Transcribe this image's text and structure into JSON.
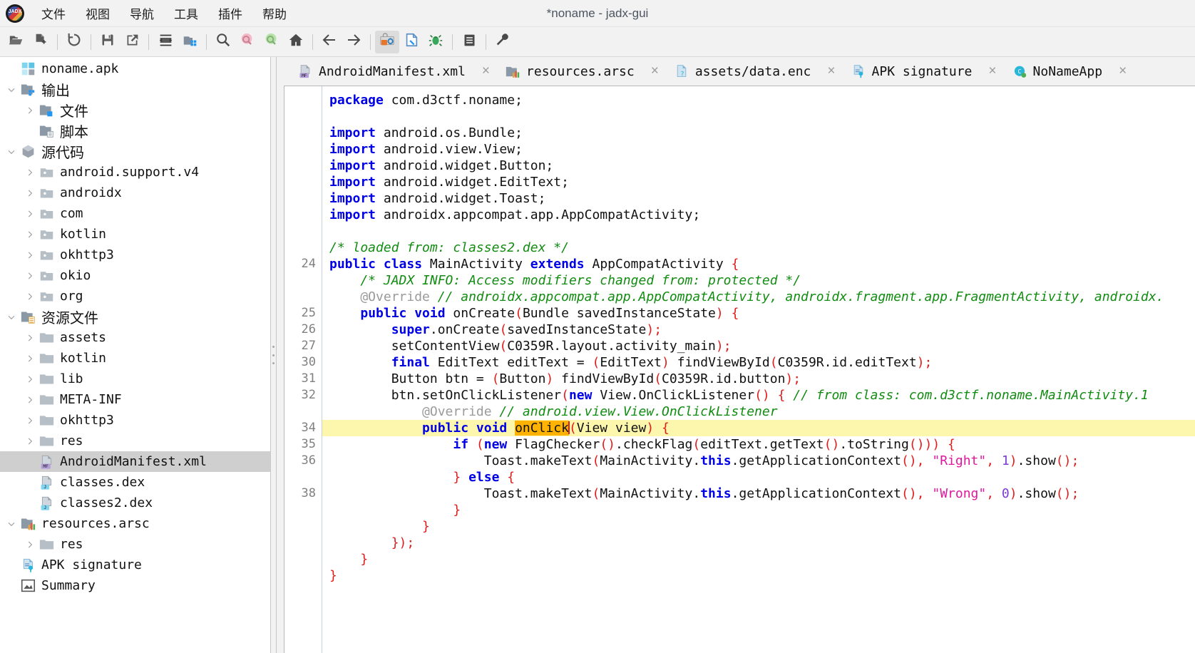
{
  "window": {
    "title": "*noname - jadx-gui",
    "logo_alt": "jadx-logo"
  },
  "menu": [
    {
      "label": "文件",
      "name": "menu-file"
    },
    {
      "label": "视图",
      "name": "menu-view"
    },
    {
      "label": "导航",
      "name": "menu-navigation"
    },
    {
      "label": "工具",
      "name": "menu-tools"
    },
    {
      "label": "插件",
      "name": "menu-plugins"
    },
    {
      "label": "帮助",
      "name": "menu-help"
    }
  ],
  "toolbar": [
    {
      "icon": "open-folder-icon",
      "name": "open-file-button"
    },
    {
      "icon": "add-files-icon",
      "name": "add-files-button"
    },
    {
      "sep": true
    },
    {
      "icon": "reload-icon",
      "name": "reload-button"
    },
    {
      "sep": true
    },
    {
      "icon": "save-icon",
      "name": "save-all-button"
    },
    {
      "icon": "export-icon",
      "name": "export-gradle-button"
    },
    {
      "sep": true
    },
    {
      "icon": "decompile-icon",
      "name": "sync-button"
    },
    {
      "icon": "open-project-icon",
      "name": "project-button"
    },
    {
      "sep": true
    },
    {
      "icon": "search-icon",
      "name": "text-search-button"
    },
    {
      "icon": "search-pink-icon",
      "name": "class-search-button"
    },
    {
      "icon": "search-green-icon",
      "name": "comment-search-button"
    },
    {
      "icon": "home-icon",
      "name": "home-button"
    },
    {
      "sep": true
    },
    {
      "icon": "arrow-back-icon",
      "name": "back-button"
    },
    {
      "icon": "arrow-forward-icon",
      "name": "forward-button"
    },
    {
      "sep": true
    },
    {
      "icon": "deobfuscation-icon",
      "name": "deobfuscation-button",
      "active": true
    },
    {
      "icon": "quark-icon",
      "name": "quark-button"
    },
    {
      "icon": "bug-icon",
      "name": "debugger-button"
    },
    {
      "sep": true
    },
    {
      "icon": "log-icon",
      "name": "logs-button"
    },
    {
      "sep": true
    },
    {
      "icon": "wrench-icon",
      "name": "preferences-button"
    }
  ],
  "sidebar": {
    "nodes": [
      {
        "label": "noname.apk",
        "indent": 0,
        "twisty": "none",
        "icon": "apk-icon",
        "cjk": false
      },
      {
        "label": "输出",
        "indent": 0,
        "twisty": "expanded",
        "icon": "folder-out-icon",
        "cjk": true
      },
      {
        "label": "文件",
        "indent": 1,
        "twisty": "collapsed",
        "icon": "folder-blue-icon",
        "cjk": true
      },
      {
        "label": "脚本",
        "indent": 1,
        "twisty": "none",
        "icon": "folder-doc-icon",
        "cjk": true
      },
      {
        "label": "源代码",
        "indent": 0,
        "twisty": "expanded",
        "icon": "package-icon",
        "cjk": true
      },
      {
        "label": "android.support.v4",
        "indent": 1,
        "twisty": "collapsed",
        "icon": "pkg-folder-icon",
        "cjk": false
      },
      {
        "label": "androidx",
        "indent": 1,
        "twisty": "collapsed",
        "icon": "pkg-folder-icon",
        "cjk": false
      },
      {
        "label": "com",
        "indent": 1,
        "twisty": "collapsed",
        "icon": "pkg-folder-icon",
        "cjk": false
      },
      {
        "label": "kotlin",
        "indent": 1,
        "twisty": "collapsed",
        "icon": "pkg-folder-icon",
        "cjk": false
      },
      {
        "label": "okhttp3",
        "indent": 1,
        "twisty": "collapsed",
        "icon": "pkg-folder-icon",
        "cjk": false
      },
      {
        "label": "okio",
        "indent": 1,
        "twisty": "collapsed",
        "icon": "pkg-folder-icon",
        "cjk": false
      },
      {
        "label": "org",
        "indent": 1,
        "twisty": "collapsed",
        "icon": "pkg-folder-icon",
        "cjk": false
      },
      {
        "label": "资源文件",
        "indent": 0,
        "twisty": "expanded",
        "icon": "folder-res-icon",
        "cjk": true
      },
      {
        "label": "assets",
        "indent": 1,
        "twisty": "collapsed",
        "icon": "folder-icon",
        "cjk": false
      },
      {
        "label": "kotlin",
        "indent": 1,
        "twisty": "collapsed",
        "icon": "folder-icon",
        "cjk": false
      },
      {
        "label": "lib",
        "indent": 1,
        "twisty": "collapsed",
        "icon": "folder-icon",
        "cjk": false
      },
      {
        "label": "META-INF",
        "indent": 1,
        "twisty": "collapsed",
        "icon": "folder-icon",
        "cjk": false
      },
      {
        "label": "okhttp3",
        "indent": 1,
        "twisty": "collapsed",
        "icon": "folder-icon",
        "cjk": false
      },
      {
        "label": "res",
        "indent": 1,
        "twisty": "collapsed",
        "icon": "folder-icon",
        "cjk": false
      },
      {
        "label": "AndroidManifest.xml",
        "indent": 1,
        "twisty": "none",
        "icon": "manifest-icon",
        "cjk": false,
        "selected": true
      },
      {
        "label": "classes.dex",
        "indent": 1,
        "twisty": "none",
        "icon": "dex-icon",
        "cjk": false
      },
      {
        "label": "classes2.dex",
        "indent": 1,
        "twisty": "none",
        "icon": "dex-icon",
        "cjk": false
      },
      {
        "label": "resources.arsc",
        "indent": 0,
        "twisty": "expanded",
        "icon": "arsc-icon",
        "cjk": false
      },
      {
        "label": "res",
        "indent": 1,
        "twisty": "collapsed",
        "icon": "folder-icon",
        "cjk": false
      },
      {
        "label": "APK signature",
        "indent": -1,
        "twisty": "none",
        "icon": "signature-icon",
        "cjk": false
      },
      {
        "label": "Summary",
        "indent": -1,
        "twisty": "none",
        "icon": "summary-icon",
        "cjk": false
      }
    ]
  },
  "tabs": [
    {
      "label": "AndroidManifest.xml",
      "icon": "manifest-icon",
      "close": "×",
      "name": "tab-androidmanifest-xml"
    },
    {
      "label": "resources.arsc",
      "icon": "arsc-icon",
      "close": "×",
      "name": "tab-resources-arsc"
    },
    {
      "label": "assets/data.enc",
      "icon": "unknown-file-icon",
      "close": "×",
      "name": "tab-assets-data-enc"
    },
    {
      "label": "APK signature",
      "icon": "signature-icon",
      "close": "×",
      "name": "tab-apk-signature"
    },
    {
      "label": "NoNameApp",
      "icon": "class-icon",
      "close": "×",
      "name": "tab-nonameapp"
    }
  ],
  "code": {
    "lines": [
      {
        "num": "",
        "segments": [
          {
            "t": "package ",
            "c": "kw"
          },
          {
            "t": "com.d3ctf.noname;",
            "c": ""
          }
        ]
      },
      {
        "num": "",
        "segments": []
      },
      {
        "num": "",
        "segments": [
          {
            "t": "import ",
            "c": "kw"
          },
          {
            "t": "android.os.Bundle;",
            "c": ""
          }
        ]
      },
      {
        "num": "",
        "segments": [
          {
            "t": "import ",
            "c": "kw"
          },
          {
            "t": "android.view.View;",
            "c": ""
          }
        ]
      },
      {
        "num": "",
        "segments": [
          {
            "t": "import ",
            "c": "kw"
          },
          {
            "t": "android.widget.Button;",
            "c": ""
          }
        ]
      },
      {
        "num": "",
        "segments": [
          {
            "t": "import ",
            "c": "kw"
          },
          {
            "t": "android.widget.EditText;",
            "c": ""
          }
        ]
      },
      {
        "num": "",
        "segments": [
          {
            "t": "import ",
            "c": "kw"
          },
          {
            "t": "android.widget.Toast;",
            "c": ""
          }
        ]
      },
      {
        "num": "",
        "segments": [
          {
            "t": "import ",
            "c": "kw"
          },
          {
            "t": "androidx.appcompat.app.AppCompatActivity;",
            "c": ""
          }
        ]
      },
      {
        "num": "",
        "segments": []
      },
      {
        "num": "",
        "segments": [
          {
            "t": "/* loaded from: classes2.dex */",
            "c": "cm"
          }
        ]
      },
      {
        "num": "24",
        "segments": [
          {
            "t": "public class ",
            "c": "kw"
          },
          {
            "t": "MainActivity ",
            "c": ""
          },
          {
            "t": "extends ",
            "c": "kw"
          },
          {
            "t": "AppCompatActivity ",
            "c": ""
          },
          {
            "t": "{",
            "c": "pn"
          }
        ]
      },
      {
        "num": "",
        "segments": [
          {
            "t": "    /* JADX INFO: Access modifiers changed from: protected */",
            "c": "cm"
          }
        ]
      },
      {
        "num": "",
        "segments": [
          {
            "t": "    @Override ",
            "c": "an"
          },
          {
            "t": "// androidx.appcompat.app.AppCompatActivity, androidx.fragment.app.FragmentActivity, androidx.",
            "c": "cm"
          }
        ]
      },
      {
        "num": "25",
        "segments": [
          {
            "t": "    ",
            "c": ""
          },
          {
            "t": "public void ",
            "c": "kw"
          },
          {
            "t": "onCreate",
            "c": ""
          },
          {
            "t": "(",
            "c": "pn"
          },
          {
            "t": "Bundle savedInstanceState",
            "c": ""
          },
          {
            "t": ") {",
            "c": "pn"
          }
        ]
      },
      {
        "num": "26",
        "segments": [
          {
            "t": "        ",
            "c": ""
          },
          {
            "t": "super",
            "c": "kw"
          },
          {
            "t": ".onCreate",
            "c": ""
          },
          {
            "t": "(",
            "c": "pn"
          },
          {
            "t": "savedInstanceState",
            "c": ""
          },
          {
            "t": ");",
            "c": "pn"
          }
        ]
      },
      {
        "num": "27",
        "segments": [
          {
            "t": "        setContentView",
            "c": ""
          },
          {
            "t": "(",
            "c": "pn"
          },
          {
            "t": "C0359R.layout.activity_main",
            "c": ""
          },
          {
            "t": ");",
            "c": "pn"
          }
        ]
      },
      {
        "num": "30",
        "segments": [
          {
            "t": "        ",
            "c": ""
          },
          {
            "t": "final ",
            "c": "kw"
          },
          {
            "t": "EditText editText = ",
            "c": ""
          },
          {
            "t": "(",
            "c": "pn"
          },
          {
            "t": "EditText",
            "c": ""
          },
          {
            "t": ") ",
            "c": "pn"
          },
          {
            "t": "findViewById",
            "c": ""
          },
          {
            "t": "(",
            "c": "pn"
          },
          {
            "t": "C0359R.id.editText",
            "c": ""
          },
          {
            "t": ");",
            "c": "pn"
          }
        ]
      },
      {
        "num": "31",
        "segments": [
          {
            "t": "        Button btn = ",
            "c": ""
          },
          {
            "t": "(",
            "c": "pn"
          },
          {
            "t": "Button",
            "c": ""
          },
          {
            "t": ") ",
            "c": "pn"
          },
          {
            "t": "findViewById",
            "c": ""
          },
          {
            "t": "(",
            "c": "pn"
          },
          {
            "t": "C0359R.id.button",
            "c": ""
          },
          {
            "t": ");",
            "c": "pn"
          }
        ]
      },
      {
        "num": "32",
        "segments": [
          {
            "t": "        btn.setOnClickListener",
            "c": ""
          },
          {
            "t": "(",
            "c": "pn"
          },
          {
            "t": "new ",
            "c": "kw"
          },
          {
            "t": "View.OnClickListener",
            "c": ""
          },
          {
            "t": "()",
            "c": "pn"
          },
          {
            "t": " ",
            "c": ""
          },
          {
            "t": "{",
            "c": "pn"
          },
          {
            "t": " // from class: com.d3ctf.noname.MainActivity.1",
            "c": "cm"
          }
        ]
      },
      {
        "num": "",
        "segments": [
          {
            "t": "            @Override ",
            "c": "an"
          },
          {
            "t": "// android.view.View.OnClickListener",
            "c": "cm"
          }
        ]
      },
      {
        "num": "34",
        "hl": true,
        "segments": [
          {
            "t": "            ",
            "c": ""
          },
          {
            "t": "public void ",
            "c": "kw"
          },
          {
            "t": "onClick",
            "c": "sel",
            "caret": true
          },
          {
            "t": "(",
            "c": "pn"
          },
          {
            "t": "View view",
            "c": ""
          },
          {
            "t": ") {",
            "c": "pn"
          }
        ]
      },
      {
        "num": "35",
        "segments": [
          {
            "t": "                ",
            "c": ""
          },
          {
            "t": "if ",
            "c": "kw"
          },
          {
            "t": "(",
            "c": "pn"
          },
          {
            "t": "new ",
            "c": "kw"
          },
          {
            "t": "FlagChecker",
            "c": ""
          },
          {
            "t": "()",
            "c": "pn"
          },
          {
            "t": ".checkFlag",
            "c": ""
          },
          {
            "t": "(",
            "c": "pn"
          },
          {
            "t": "editText.getText",
            "c": ""
          },
          {
            "t": "()",
            "c": "pn"
          },
          {
            "t": ".toString",
            "c": ""
          },
          {
            "t": "())) {",
            "c": "pn"
          }
        ]
      },
      {
        "num": "36",
        "segments": [
          {
            "t": "                    Toast.makeText",
            "c": ""
          },
          {
            "t": "(",
            "c": "pn"
          },
          {
            "t": "MainActivity.",
            "c": ""
          },
          {
            "t": "this",
            "c": "kw"
          },
          {
            "t": ".getApplicationContext",
            "c": ""
          },
          {
            "t": "()",
            "c": "pn"
          },
          {
            "t": ", ",
            "c": "pn"
          },
          {
            "t": "\"Right\"",
            "c": "st"
          },
          {
            "t": ", ",
            "c": "pn"
          },
          {
            "t": "1",
            "c": "nm"
          },
          {
            "t": ")",
            "c": "pn"
          },
          {
            "t": ".show",
            "c": ""
          },
          {
            "t": "();",
            "c": "pn"
          }
        ]
      },
      {
        "num": "",
        "segments": [
          {
            "t": "                ",
            "c": ""
          },
          {
            "t": "}",
            "c": "pn"
          },
          {
            "t": " else ",
            "c": "kw"
          },
          {
            "t": "{",
            "c": "pn"
          }
        ]
      },
      {
        "num": "38",
        "segments": [
          {
            "t": "                    Toast.makeText",
            "c": ""
          },
          {
            "t": "(",
            "c": "pn"
          },
          {
            "t": "MainActivity.",
            "c": ""
          },
          {
            "t": "this",
            "c": "kw"
          },
          {
            "t": ".getApplicationContext",
            "c": ""
          },
          {
            "t": "()",
            "c": "pn"
          },
          {
            "t": ", ",
            "c": "pn"
          },
          {
            "t": "\"Wrong\"",
            "c": "st"
          },
          {
            "t": ", ",
            "c": "pn"
          },
          {
            "t": "0",
            "c": "nm"
          },
          {
            "t": ")",
            "c": "pn"
          },
          {
            "t": ".show",
            "c": ""
          },
          {
            "t": "();",
            "c": "pn"
          }
        ]
      },
      {
        "num": "",
        "segments": [
          {
            "t": "                ",
            "c": ""
          },
          {
            "t": "}",
            "c": "pn"
          }
        ]
      },
      {
        "num": "",
        "segments": [
          {
            "t": "            ",
            "c": ""
          },
          {
            "t": "}",
            "c": "pn"
          }
        ]
      },
      {
        "num": "",
        "segments": [
          {
            "t": "        ",
            "c": ""
          },
          {
            "t": "});",
            "c": "pn"
          }
        ]
      },
      {
        "num": "",
        "segments": [
          {
            "t": "    ",
            "c": ""
          },
          {
            "t": "}",
            "c": "pn"
          }
        ]
      },
      {
        "num": "",
        "segments": [
          {
            "t": "",
            "c": ""
          },
          {
            "t": "}",
            "c": "pn"
          }
        ]
      }
    ]
  },
  "colors": {
    "keyword": "#0000e6",
    "comment": "#118c11",
    "paren": "#e01b1b",
    "string": "#e0189e",
    "number": "#7a3bd8",
    "selection": "#ffb300",
    "line_highlight": "#fdf7ad",
    "tree_selection": "#cfcfcf"
  }
}
